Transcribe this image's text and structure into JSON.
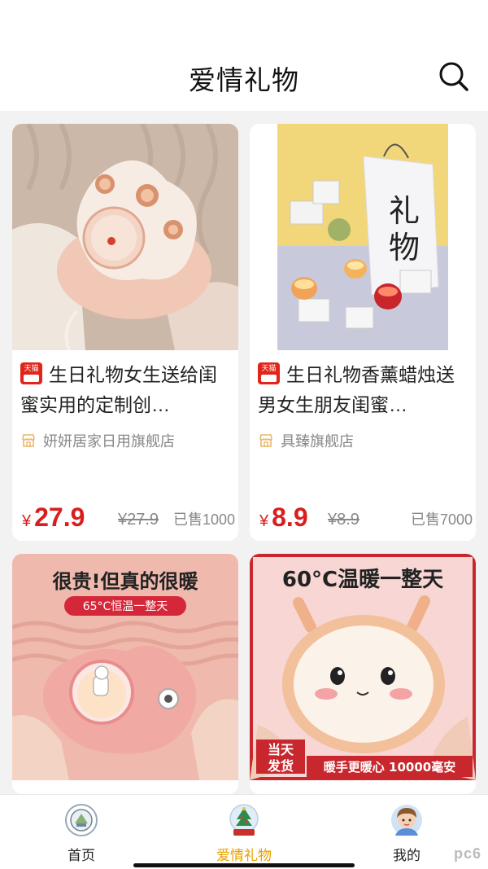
{
  "header": {
    "title": "爱情礼物",
    "search_icon": "search-icon"
  },
  "products": [
    {
      "badge": "天猫",
      "title": "生日礼物女生送给闺蜜实用的定制创…",
      "shop": "妍妍居家日用旗舰店",
      "currency": "¥",
      "price": "27.9",
      "original_price": "¥27.9",
      "sold": "已售1000",
      "image": "paw-hand-warmer"
    },
    {
      "badge": "天猫",
      "title": "生日礼物香薰蜡烛送男女生朋友闺蜜…",
      "shop": "具臻旗舰店",
      "currency": "¥",
      "price": "8.9",
      "original_price": "¥8.9",
      "sold": "已售7000",
      "image": "candle-gift-set",
      "image_text": "礼物"
    },
    {
      "image": "pink-hand-warmer",
      "image_text_main": "很贵!但真的很暖",
      "image_text_sub": "65°C恒温一整天"
    },
    {
      "image": "bunny-hand-warmer",
      "image_text_main": "60°C温暖一整天",
      "image_text_tag": "当天发货",
      "image_text_bottom": "暖手更暖心 10000毫安"
    }
  ],
  "tabbar": {
    "items": [
      {
        "label": "首页",
        "icon": "seal-icon"
      },
      {
        "label": "爱情礼物",
        "icon": "christmas-tree-icon"
      },
      {
        "label": "我的",
        "icon": "avatar-icon"
      }
    ],
    "active": "爱情礼物",
    "active_color": "#e6a100"
  },
  "watermark": "pc6"
}
